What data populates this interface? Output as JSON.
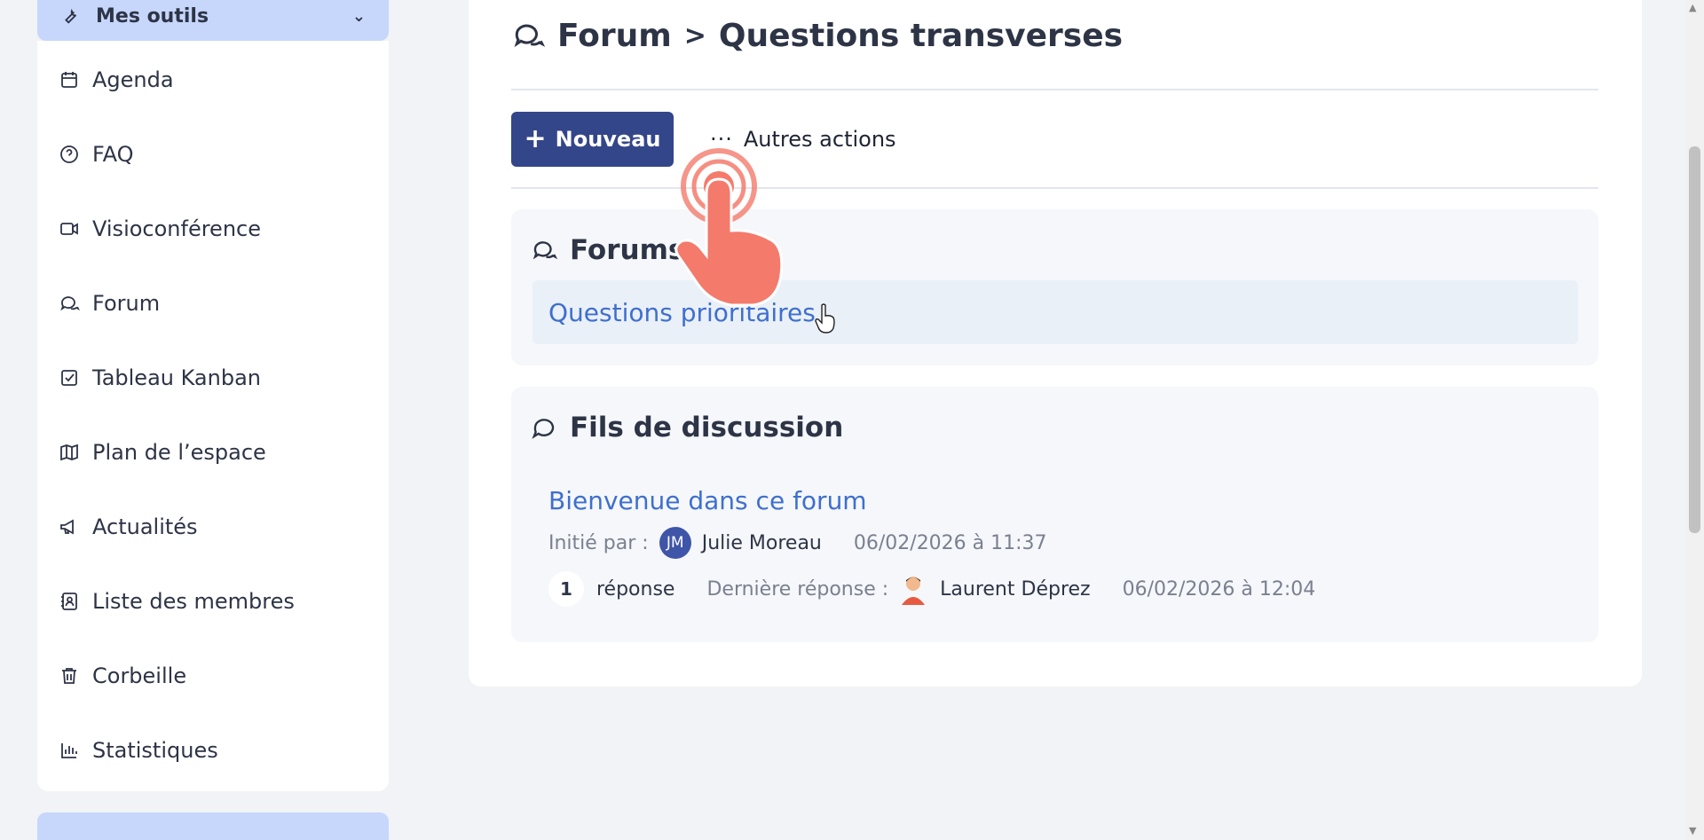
{
  "sidebar": {
    "tools_label": "Mes outils",
    "items": [
      {
        "label": "Agenda",
        "icon": "calendar-icon"
      },
      {
        "label": "FAQ",
        "icon": "help-circle-icon"
      },
      {
        "label": "Visioconférence",
        "icon": "video-icon"
      },
      {
        "label": "Forum",
        "icon": "chat-bubbles-icon"
      },
      {
        "label": "Tableau Kanban",
        "icon": "checkbox-icon"
      },
      {
        "label": "Plan de l’espace",
        "icon": "map-icon"
      },
      {
        "label": "Actualités",
        "icon": "megaphone-icon"
      },
      {
        "label": "Liste des membres",
        "icon": "contact-card-icon"
      },
      {
        "label": "Corbeille",
        "icon": "trash-icon"
      },
      {
        "label": "Statistiques",
        "icon": "bar-chart-icon"
      }
    ]
  },
  "header": {
    "crumb_root": "Forum",
    "crumb_separator": ">",
    "crumb_current": "Questions transverses"
  },
  "toolbar": {
    "new_label": "Nouveau",
    "more_label": "Autres actions"
  },
  "forums": {
    "title": "Forums",
    "items": [
      {
        "label": "Questions prioritaires"
      }
    ]
  },
  "threads": {
    "title": "Fils de discussion",
    "items": [
      {
        "title": "Bienvenue dans ce forum",
        "initiated_label": "Initié par :",
        "author_initials": "JM",
        "author": "Julie Moreau",
        "created": "06/02/2026 à 11:37",
        "reply_count": "1",
        "reply_label": "réponse",
        "last_reply_label": "Dernière réponse :",
        "last_author": "Laurent Déprez",
        "last_date": "06/02/2026 à 12:04"
      }
    ]
  },
  "colors": {
    "primary": "#34468a",
    "link": "#3e6fcf",
    "sidebar_accent": "#c7d6fb"
  }
}
